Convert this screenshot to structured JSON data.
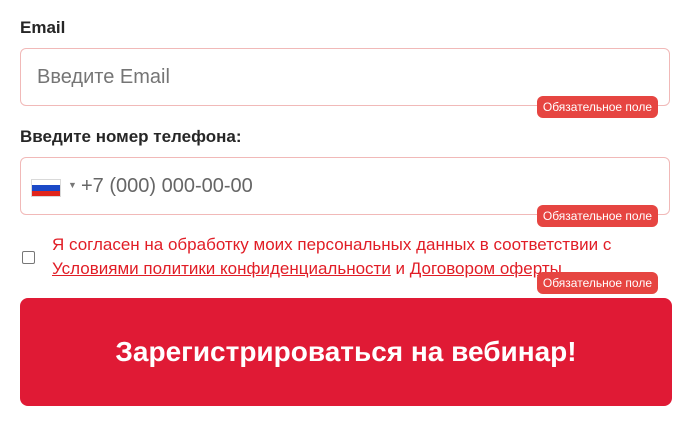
{
  "email": {
    "label": "Email",
    "placeholder": "Введите Email",
    "required_badge": "Обязательное поле"
  },
  "phone": {
    "label": "Введите номер телефона:",
    "placeholder": "+7 (000) 000-00-00",
    "country_flag": "russia-flag-icon",
    "required_badge": "Обязательное поле"
  },
  "consent": {
    "text_before": "Я согласен на обработку моих персональных данных в соответствии с ",
    "policy_link": "Условиями политики конфиденциальности",
    "text_between": " и ",
    "offer_link": "Договором оферты.",
    "required_badge": "Обязательное поле"
  },
  "submit": {
    "label": "Зарегистрироваться на вебинар!"
  },
  "colors": {
    "accent_red": "#e01a35",
    "badge_red": "#e64541",
    "consent_text": "#e11d26",
    "field_border": "#f1b9b8"
  }
}
